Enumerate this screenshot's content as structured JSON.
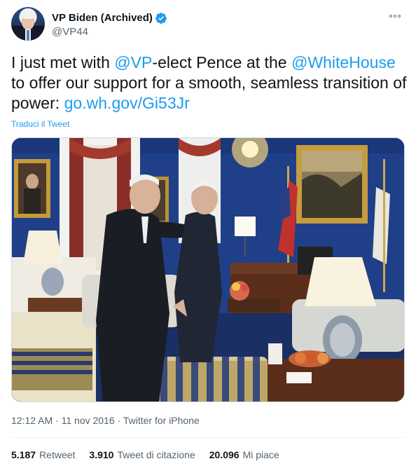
{
  "author": {
    "display_name": "VP Biden (Archived)",
    "handle": "@VP44",
    "verified": true
  },
  "tweet": {
    "text_part1": "I just met with ",
    "mention_vp": "@VP",
    "text_part2": "-elect Pence at the ",
    "mention_whitehouse": "@WhiteHouse",
    "text_part3": " to offer our support for a smooth, seamless transition of power: ",
    "link": "go.wh.gov/Gi53Jr",
    "translate_label": "Traduci il Tweet"
  },
  "meta": {
    "time": "12:12 AM",
    "date": "11 nov 2016",
    "separator": "·",
    "source": "Twitter for iPhone"
  },
  "stats": {
    "retweets_count": "5.187",
    "retweets_label": "Retweet",
    "quotes_count": "3.910",
    "quotes_label": "Tweet di citazione",
    "likes_count": "20.096",
    "likes_label": "Mi piace"
  },
  "colors": {
    "accent": "#1d9bf0",
    "wall": "#1e3d86"
  },
  "icons": [
    "verified-badge-icon",
    "more-options-icon"
  ]
}
